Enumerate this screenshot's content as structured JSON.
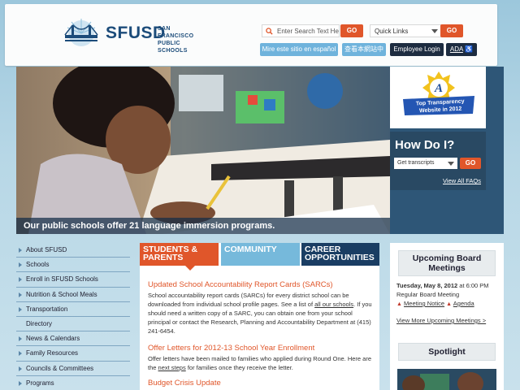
{
  "header": {
    "logo_title": "SFUSD",
    "logo_sub_line1": "SAN FRANCISCO",
    "logo_sub_line2": "PUBLIC SCHOOLS",
    "search_placeholder": "Enter Search Text He",
    "search_go": "GO",
    "quick_links": "Quick Links",
    "quick_go": "GO",
    "spanish_link": "Mire este sitio en español",
    "chinese_link": "查看本網站中",
    "employee_login": "Employee Login",
    "ada": "ADA"
  },
  "hero": {
    "caption": "Our public schools offer 21 language immersion programs."
  },
  "side": {
    "award_line1": "Top Transparency",
    "award_line2": "Website in 2012",
    "how_do_i": "How Do I?",
    "select_value": "Get transcripts",
    "go": "GO",
    "view_faqs": "View All FAQs"
  },
  "nav": {
    "items": [
      "About SFUSD",
      "Schools",
      "Enroll in SFUSD Schools",
      "Nutrition & School Meals",
      "Transportation",
      "Directory",
      "News & Calendars",
      "Family Resources",
      "Councils & Committees",
      "Programs"
    ]
  },
  "tabs": {
    "students_1": "STUDENTS &",
    "students_2": "PARENTS",
    "community": "COMMUNITY",
    "career_1": "CAREER",
    "career_2": "OPPORTUNITIES"
  },
  "articles": {
    "a1_title": "Updated School Accountability Report Cards (SARCs)",
    "a1_body1": "School accountability report cards (SARCs) for every district school can be downloaded from individual school profile pages. See a list of",
    "a1_link": "all our schools",
    "a1_body2": ". If you should need a written copy of a SARC, you can obtain one from your school principal or contact the Research, Planning and Accountability Department at (415) 241-6454.",
    "a2_title": "Offer Letters for 2012-13 School Year Enrollment",
    "a2_body1": "Offer letters have been mailed to families who applied during Round One. Here are the",
    "a2_link": "next steps",
    "a2_body2": "for families once they receive the letter.",
    "a3_title": "Budget Crisis Update"
  },
  "right": {
    "meetings_title_1": "Upcoming Board",
    "meetings_title_2": "Meetings",
    "meeting_date": "Tuesday, May 8, 2012",
    "meeting_time": "at 6:00 PM",
    "meeting_name": "Regular Board Meeting",
    "meeting_notice": "Meeting Notice",
    "meeting_agenda": "Agenda",
    "view_more": "View More Upcoming Meetings >",
    "spotlight": "Spotlight"
  },
  "colors": {
    "accent_orange": "#e0562a",
    "navy": "#1a3d63",
    "light_blue": "#76b9db"
  }
}
